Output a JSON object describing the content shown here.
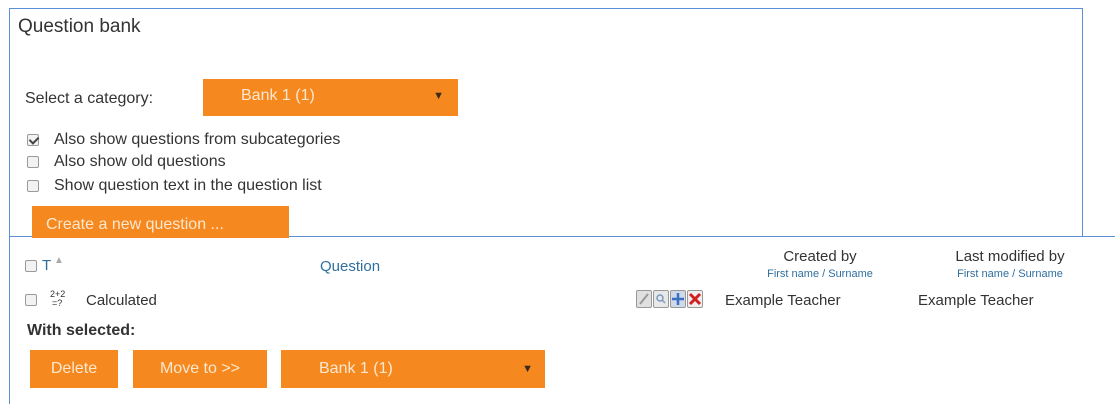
{
  "header": {
    "title": "Question bank"
  },
  "category": {
    "label": "Select a category:",
    "selected": "Bank 1 (1)"
  },
  "options": [
    {
      "label": "Also show questions from subcategories",
      "checked": true
    },
    {
      "label": "Also show old questions",
      "checked": false
    },
    {
      "label": "Show question text in the question list",
      "checked": false
    }
  ],
  "create_button": "Create a new question ...",
  "table": {
    "col_type": "T",
    "col_question": "Question",
    "col_created": "Created by",
    "col_created_sub": "First name / Surname",
    "col_modified": "Last modified by",
    "col_modified_sub": "First name / Surname",
    "rows": [
      {
        "type_icon": "calculated-icon",
        "type_glyph_top": "2+2",
        "type_glyph_bottom": "=?",
        "name": "Calculated",
        "created_by": "Example Teacher",
        "modified_by": "Example Teacher",
        "actions": [
          "edit-icon",
          "preview-icon",
          "move-icon",
          "delete-icon"
        ]
      }
    ]
  },
  "with_selected": {
    "label": "With selected:",
    "delete": "Delete",
    "move_to": "Move to >>",
    "target": "Bank 1 (1)"
  },
  "colors": {
    "accent": "#f5891f",
    "link": "#2f6f9f",
    "border": "#5b8fd6"
  }
}
